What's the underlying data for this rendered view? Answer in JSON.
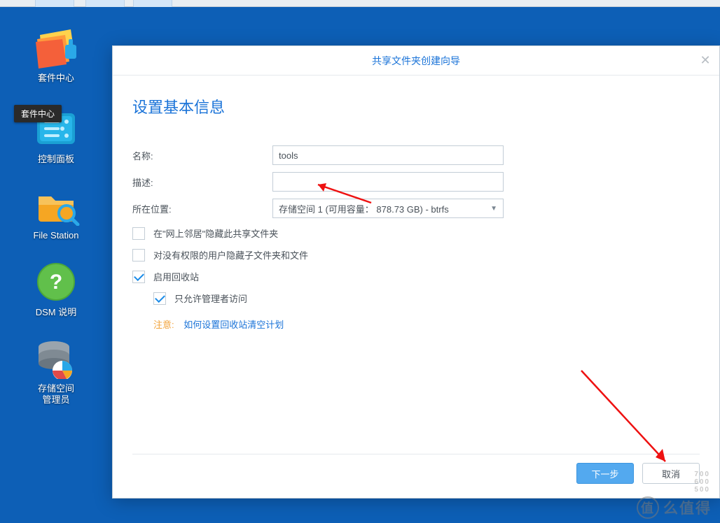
{
  "desktop": {
    "icons": [
      {
        "id": "package-center",
        "label": "套件中心"
      },
      {
        "id": "control-panel",
        "label": "控制面板"
      },
      {
        "id": "file-station",
        "label": "File Station"
      },
      {
        "id": "dsm-help",
        "label": "DSM 说明"
      },
      {
        "id": "storage-mgr",
        "label": "存储空间\n管理员"
      }
    ],
    "tooltip": "套件中心"
  },
  "dialog": {
    "title": "共享文件夹创建向导",
    "heading": "设置基本信息",
    "labels": {
      "name": "名称:",
      "desc": "描述:",
      "location": "所在位置:"
    },
    "values": {
      "name": "tools",
      "desc": "",
      "location": "存储空间 1 (可用容量： 878.73 GB) - btrfs"
    },
    "checks": {
      "hide_network": {
        "label": "在\"网上邻居\"隐藏此共享文件夹",
        "checked": false
      },
      "hide_noperm": {
        "label": "对没有权限的用户隐藏子文件夹和文件",
        "checked": false
      },
      "recycle": {
        "label": "启用回收站",
        "checked": true
      },
      "admin_only": {
        "label": "只允许管理者访问",
        "checked": true
      }
    },
    "note": {
      "warn": "注意:",
      "link": "如何设置回收站清空计划"
    },
    "buttons": {
      "next": "下一步",
      "cancel": "取消"
    }
  },
  "watermark": {
    "text": "么值得"
  }
}
